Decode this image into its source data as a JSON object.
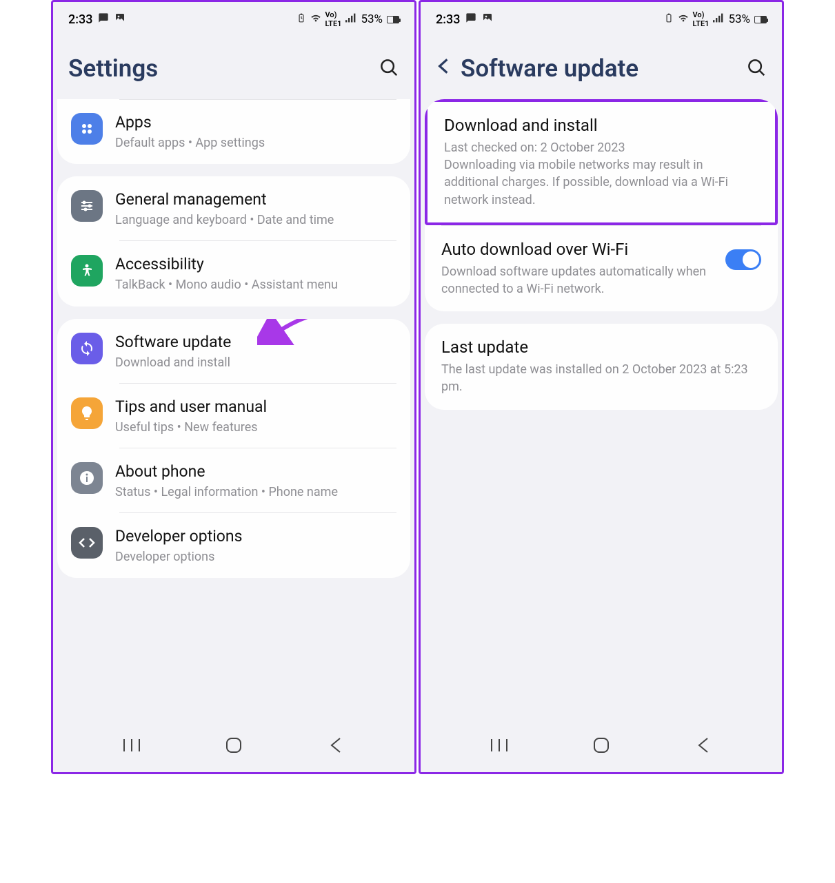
{
  "status": {
    "time": "2:33",
    "battery_text": "53%"
  },
  "left_screen": {
    "title": "Settings",
    "cards": [
      {
        "items": [
          {
            "title": "Apps",
            "subtitle": "Default apps  •  App settings",
            "icon": "apps"
          }
        ],
        "partial_top": true
      },
      {
        "items": [
          {
            "title": "General management",
            "subtitle": "Language and keyboard  •  Date and time",
            "icon": "general"
          },
          {
            "title": "Accessibility",
            "subtitle": "TalkBack  •  Mono audio  •  Assistant menu",
            "icon": "accessibility"
          }
        ]
      },
      {
        "items": [
          {
            "title": "Software update",
            "subtitle": "Download and install",
            "icon": "software",
            "has_arrow": true
          },
          {
            "title": "Tips and user manual",
            "subtitle": "Useful tips  •  New features",
            "icon": "tips"
          },
          {
            "title": "About phone",
            "subtitle": "Status  •  Legal information  •  Phone name",
            "icon": "about"
          },
          {
            "title": "Developer options",
            "subtitle": "Developer options",
            "icon": "developer"
          }
        ]
      }
    ]
  },
  "right_screen": {
    "title": "Software update",
    "download": {
      "title": "Download and install",
      "line1": "Last checked on: 2 October 2023",
      "line2": "Downloading via mobile networks may result in additional charges. If possible, download via a Wi-Fi network instead."
    },
    "auto": {
      "title": "Auto download over Wi-Fi",
      "desc": "Download software updates automatically when connected to a Wi-Fi network.",
      "enabled": true
    },
    "last": {
      "title": "Last update",
      "desc": "The last update was installed on 2 October 2023 at 5:23 pm."
    }
  }
}
